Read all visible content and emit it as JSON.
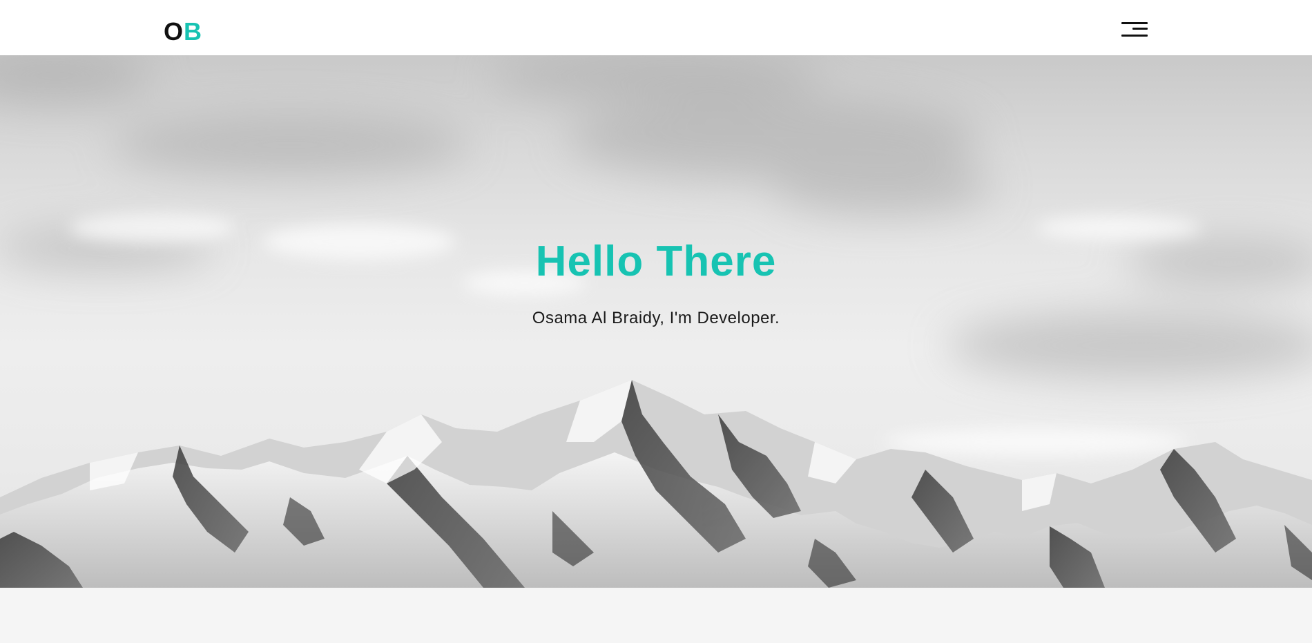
{
  "colors": {
    "accent": "#17c3b2",
    "dark": "#111111"
  },
  "navbar": {
    "logo_first": "O",
    "logo_second": "B",
    "menu_icon": "hamburger-menu-icon"
  },
  "hero": {
    "title": "Hello There",
    "subtitle": "Osama Al Braidy, I'm Developer.",
    "background": "mountain-range-image"
  }
}
